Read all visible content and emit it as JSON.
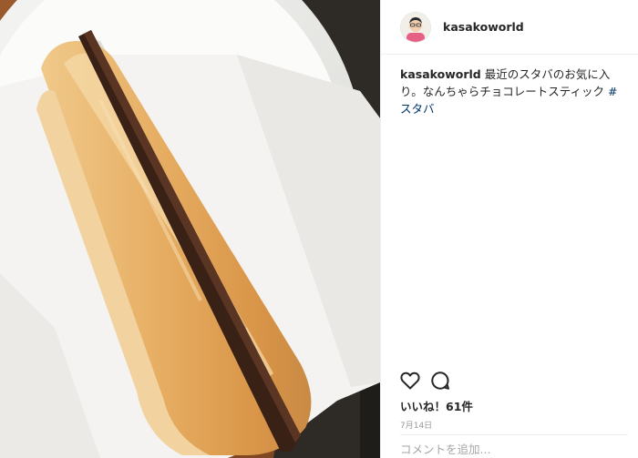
{
  "post": {
    "username": "kasakoworld",
    "caption_text": " 最近のスタバのお気に入り。なんちゃらチョコレートスティック ",
    "hashtag": "#スタバ",
    "likes_label": "いいね！61件",
    "date": "7月14日",
    "comment_placeholder": "コメントを追加..."
  },
  "icons": {
    "like": "heart-icon",
    "comment": "comment-icon"
  },
  "colors": {
    "text": "#262626",
    "hashtag": "#003569",
    "muted": "#999999",
    "table": "#8a4e25",
    "chocolate": "#3a2116",
    "pastry": "#e2a760"
  }
}
